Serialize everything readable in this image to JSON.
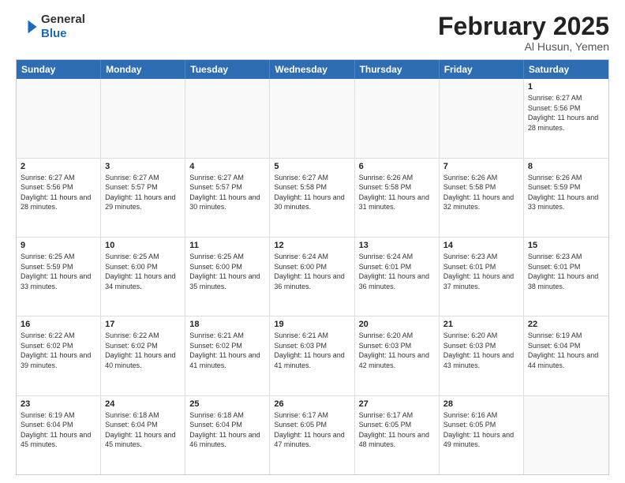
{
  "logo": {
    "general": "General",
    "blue": "Blue"
  },
  "header": {
    "title": "February 2025",
    "subtitle": "Al Husun, Yemen"
  },
  "weekdays": [
    "Sunday",
    "Monday",
    "Tuesday",
    "Wednesday",
    "Thursday",
    "Friday",
    "Saturday"
  ],
  "weeks": [
    [
      {
        "day": "",
        "info": ""
      },
      {
        "day": "",
        "info": ""
      },
      {
        "day": "",
        "info": ""
      },
      {
        "day": "",
        "info": ""
      },
      {
        "day": "",
        "info": ""
      },
      {
        "day": "",
        "info": ""
      },
      {
        "day": "1",
        "info": "Sunrise: 6:27 AM\nSunset: 5:56 PM\nDaylight: 11 hours and 28 minutes."
      }
    ],
    [
      {
        "day": "2",
        "info": "Sunrise: 6:27 AM\nSunset: 5:56 PM\nDaylight: 11 hours and 28 minutes."
      },
      {
        "day": "3",
        "info": "Sunrise: 6:27 AM\nSunset: 5:57 PM\nDaylight: 11 hours and 29 minutes."
      },
      {
        "day": "4",
        "info": "Sunrise: 6:27 AM\nSunset: 5:57 PM\nDaylight: 11 hours and 30 minutes."
      },
      {
        "day": "5",
        "info": "Sunrise: 6:27 AM\nSunset: 5:58 PM\nDaylight: 11 hours and 30 minutes."
      },
      {
        "day": "6",
        "info": "Sunrise: 6:26 AM\nSunset: 5:58 PM\nDaylight: 11 hours and 31 minutes."
      },
      {
        "day": "7",
        "info": "Sunrise: 6:26 AM\nSunset: 5:58 PM\nDaylight: 11 hours and 32 minutes."
      },
      {
        "day": "8",
        "info": "Sunrise: 6:26 AM\nSunset: 5:59 PM\nDaylight: 11 hours and 33 minutes."
      }
    ],
    [
      {
        "day": "9",
        "info": "Sunrise: 6:25 AM\nSunset: 5:59 PM\nDaylight: 11 hours and 33 minutes."
      },
      {
        "day": "10",
        "info": "Sunrise: 6:25 AM\nSunset: 6:00 PM\nDaylight: 11 hours and 34 minutes."
      },
      {
        "day": "11",
        "info": "Sunrise: 6:25 AM\nSunset: 6:00 PM\nDaylight: 11 hours and 35 minutes."
      },
      {
        "day": "12",
        "info": "Sunrise: 6:24 AM\nSunset: 6:00 PM\nDaylight: 11 hours and 36 minutes."
      },
      {
        "day": "13",
        "info": "Sunrise: 6:24 AM\nSunset: 6:01 PM\nDaylight: 11 hours and 36 minutes."
      },
      {
        "day": "14",
        "info": "Sunrise: 6:23 AM\nSunset: 6:01 PM\nDaylight: 11 hours and 37 minutes."
      },
      {
        "day": "15",
        "info": "Sunrise: 6:23 AM\nSunset: 6:01 PM\nDaylight: 11 hours and 38 minutes."
      }
    ],
    [
      {
        "day": "16",
        "info": "Sunrise: 6:22 AM\nSunset: 6:02 PM\nDaylight: 11 hours and 39 minutes."
      },
      {
        "day": "17",
        "info": "Sunrise: 6:22 AM\nSunset: 6:02 PM\nDaylight: 11 hours and 40 minutes."
      },
      {
        "day": "18",
        "info": "Sunrise: 6:21 AM\nSunset: 6:02 PM\nDaylight: 11 hours and 41 minutes."
      },
      {
        "day": "19",
        "info": "Sunrise: 6:21 AM\nSunset: 6:03 PM\nDaylight: 11 hours and 41 minutes."
      },
      {
        "day": "20",
        "info": "Sunrise: 6:20 AM\nSunset: 6:03 PM\nDaylight: 11 hours and 42 minutes."
      },
      {
        "day": "21",
        "info": "Sunrise: 6:20 AM\nSunset: 6:03 PM\nDaylight: 11 hours and 43 minutes."
      },
      {
        "day": "22",
        "info": "Sunrise: 6:19 AM\nSunset: 6:04 PM\nDaylight: 11 hours and 44 minutes."
      }
    ],
    [
      {
        "day": "23",
        "info": "Sunrise: 6:19 AM\nSunset: 6:04 PM\nDaylight: 11 hours and 45 minutes."
      },
      {
        "day": "24",
        "info": "Sunrise: 6:18 AM\nSunset: 6:04 PM\nDaylight: 11 hours and 45 minutes."
      },
      {
        "day": "25",
        "info": "Sunrise: 6:18 AM\nSunset: 6:04 PM\nDaylight: 11 hours and 46 minutes."
      },
      {
        "day": "26",
        "info": "Sunrise: 6:17 AM\nSunset: 6:05 PM\nDaylight: 11 hours and 47 minutes."
      },
      {
        "day": "27",
        "info": "Sunrise: 6:17 AM\nSunset: 6:05 PM\nDaylight: 11 hours and 48 minutes."
      },
      {
        "day": "28",
        "info": "Sunrise: 6:16 AM\nSunset: 6:05 PM\nDaylight: 11 hours and 49 minutes."
      },
      {
        "day": "",
        "info": ""
      }
    ]
  ]
}
